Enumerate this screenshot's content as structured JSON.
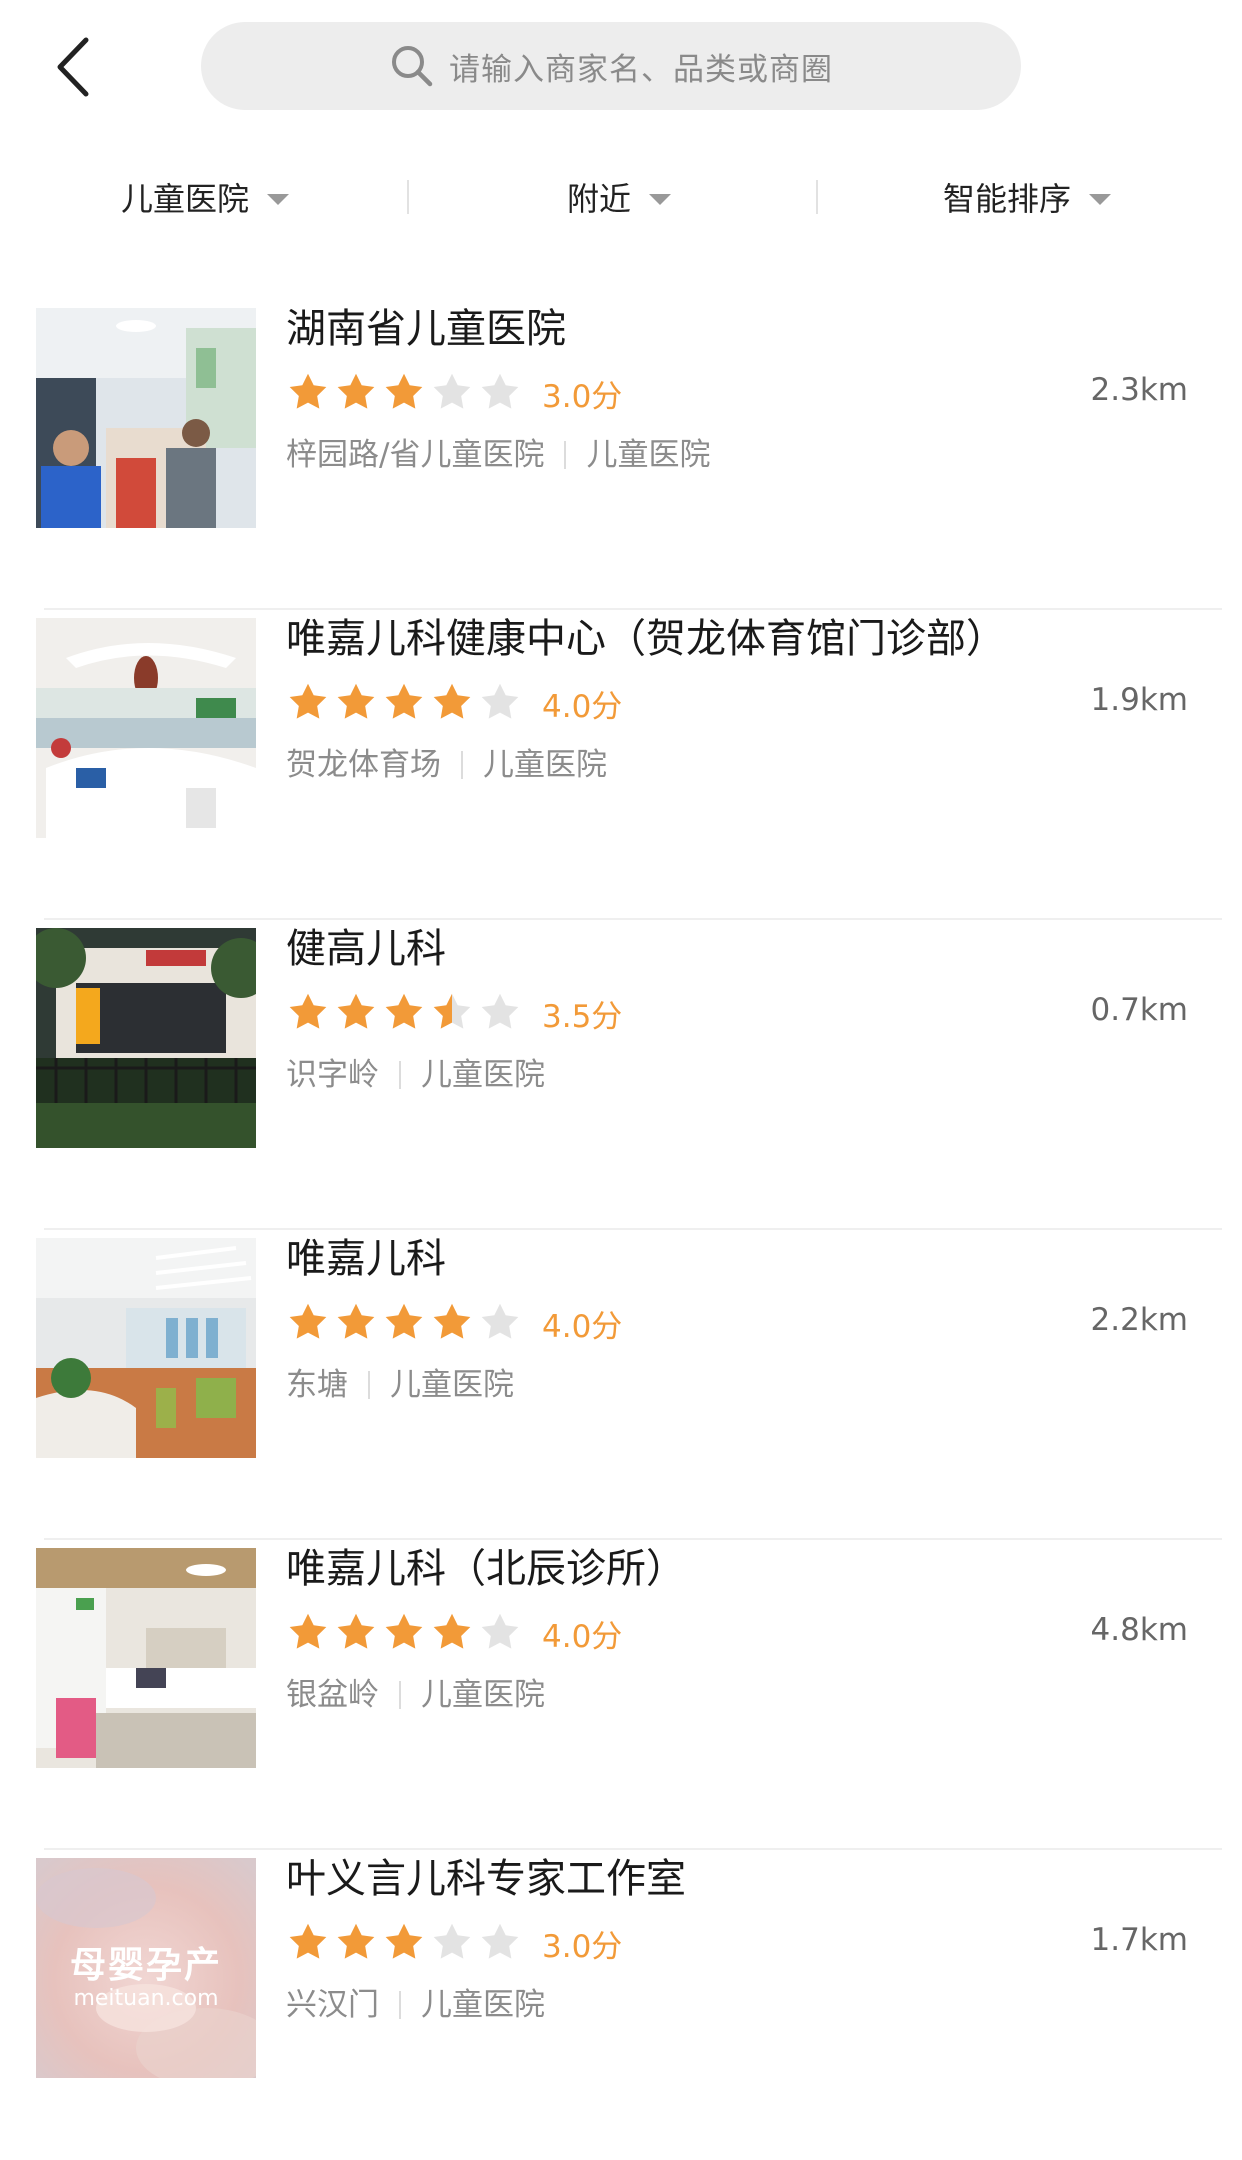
{
  "search": {
    "placeholder": "请输入商家名、品类或商圈"
  },
  "filters": [
    {
      "label": "儿童医院"
    },
    {
      "label": "附近"
    },
    {
      "label": "智能排序"
    }
  ],
  "colors": {
    "accent": "#f29a38",
    "star_filled": "#f29a38",
    "star_empty": "#e3e3e3"
  },
  "listings": [
    {
      "name": "湖南省儿童医院",
      "rating": 3.0,
      "score": "3.0分",
      "distance": "2.3km",
      "area": "梓园路/省儿童医院",
      "category": "儿童医院"
    },
    {
      "name": "唯嘉儿科健康中心（贺龙体育馆门诊部）",
      "rating": 4.0,
      "score": "4.0分",
      "distance": "1.9km",
      "area": "贺龙体育场",
      "category": "儿童医院"
    },
    {
      "name": "健高儿科",
      "rating": 3.5,
      "score": "3.5分",
      "distance": "0.7km",
      "area": "识字岭",
      "category": "儿童医院"
    },
    {
      "name": "唯嘉儿科",
      "rating": 4.0,
      "score": "4.0分",
      "distance": "2.2km",
      "area": "东塘",
      "category": "儿童医院"
    },
    {
      "name": "唯嘉儿科（北辰诊所）",
      "rating": 4.0,
      "score": "4.0分",
      "distance": "4.8km",
      "area": "银盆岭",
      "category": "儿童医院"
    },
    {
      "name": "叶义言儿科专家工作室",
      "rating": 3.0,
      "score": "3.0分",
      "distance": "1.7km",
      "area": "兴汉门",
      "category": "儿童医院",
      "thumbnail_text": {
        "title": "母婴孕产",
        "subtitle": "meituan.com"
      }
    }
  ]
}
